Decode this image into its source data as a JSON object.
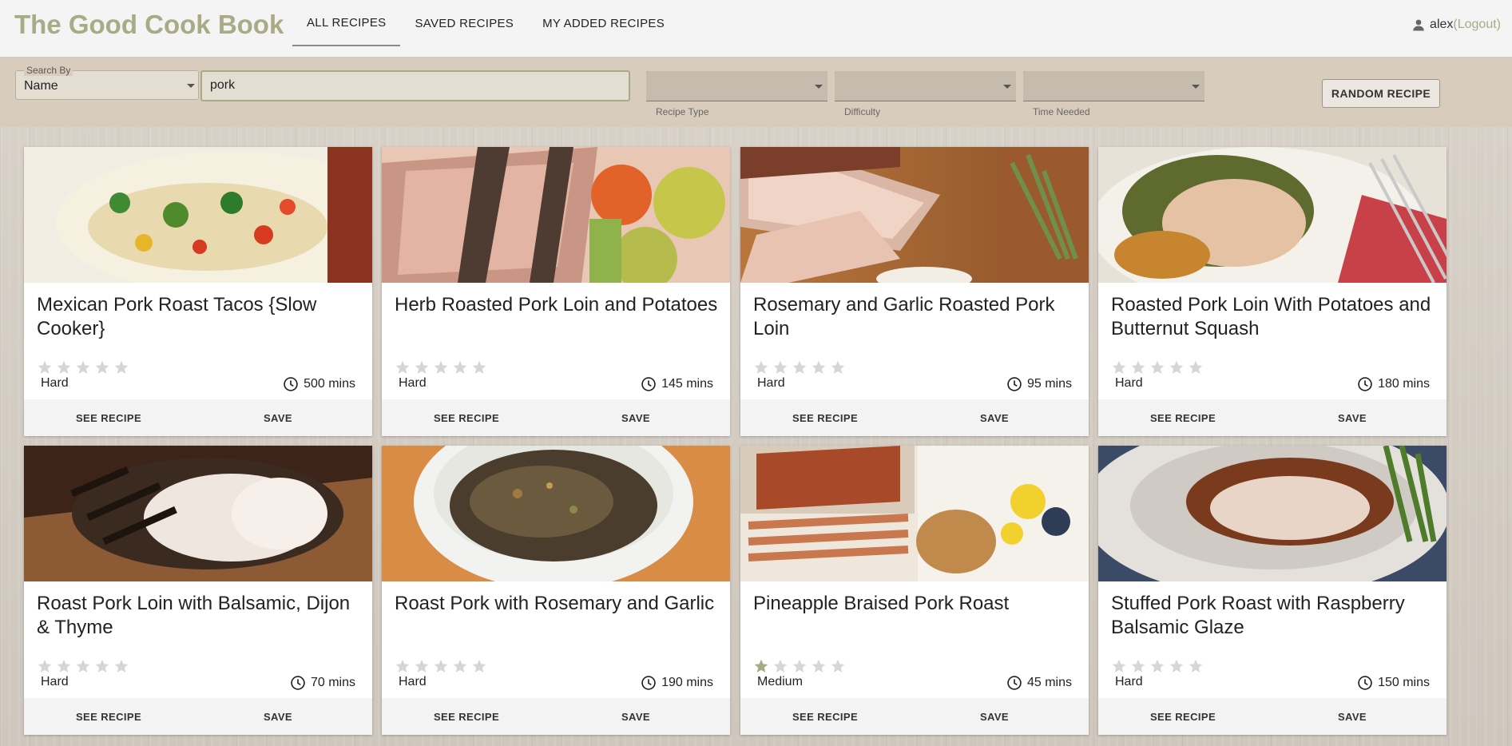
{
  "header": {
    "brand": "The Good Cook Book",
    "tabs": [
      {
        "label": "ALL RECIPES",
        "active": true
      },
      {
        "label": "SAVED RECIPES",
        "active": false
      },
      {
        "label": "MY ADDED RECIPES",
        "active": false
      }
    ],
    "user": {
      "name": "alex",
      "logout": "(Logout)"
    }
  },
  "filters": {
    "search_by_label": "Search By",
    "search_by_value": "Name",
    "search_value": "pork",
    "recipe_type_label": "Recipe Type",
    "difficulty_label": "Difficulty",
    "time_needed_label": "Time Needed",
    "random_button": "RANDOM RECIPE"
  },
  "colors": {
    "accent": "#a8ab85",
    "star_filled": "#a8ab85",
    "star_empty": "#d6d6d6"
  },
  "card_actions": {
    "see": "SEE RECIPE",
    "save": "SAVE"
  },
  "recipes": [
    {
      "title": "Mexican Pork Roast Tacos {Slow Cooker}",
      "rating": 0,
      "difficulty": "Hard",
      "time": "500 mins"
    },
    {
      "title": "Herb Roasted Pork Loin and Potatoes",
      "rating": 0,
      "difficulty": "Hard",
      "time": "145 mins"
    },
    {
      "title": "Rosemary and Garlic Roasted Pork Loin",
      "rating": 0,
      "difficulty": "Hard",
      "time": "95 mins"
    },
    {
      "title": "Roasted Pork Loin With Potatoes and Butternut Squash",
      "rating": 0,
      "difficulty": "Hard",
      "time": "180 mins"
    },
    {
      "title": "Roast Pork Loin with Balsamic, Dijon & Thyme",
      "rating": 0,
      "difficulty": "Hard",
      "time": "70 mins"
    },
    {
      "title": "Roast Pork with Rosemary and Garlic",
      "rating": 0,
      "difficulty": "Hard",
      "time": "190 mins"
    },
    {
      "title": "Pineapple Braised Pork Roast",
      "rating": 1,
      "difficulty": "Medium",
      "time": "45 mins"
    },
    {
      "title": "Stuffed Pork Roast with Raspberry Balsamic Glaze",
      "rating": 0,
      "difficulty": "Hard",
      "time": "150 mins"
    }
  ]
}
